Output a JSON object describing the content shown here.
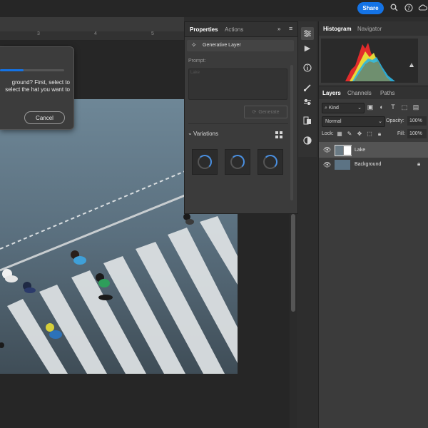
{
  "topbar": {
    "share_label": "Share",
    "icons": [
      "search-icon",
      "help-icon",
      "cloud-icon"
    ]
  },
  "ruler": {
    "ticks": [
      "3",
      "4",
      "5"
    ]
  },
  "dialog": {
    "message": "ground? First, select to select the hat you want to",
    "cancel_label": "Cancel",
    "progress_percent": 37
  },
  "properties": {
    "tabs": [
      "Properties",
      "Actions"
    ],
    "layer_type": "Generative Layer",
    "prompt_label": "Prompt:",
    "prompt_placeholder": "Lake",
    "generate_label": "Generate",
    "variations_label": "Variations"
  },
  "histogram": {
    "tabs": [
      "Histogram",
      "Navigator"
    ]
  },
  "layers": {
    "tabs": [
      "Layers",
      "Channels",
      "Paths"
    ],
    "kind_label": "Kind",
    "blend_mode": "Normal",
    "opacity_label": "Opacity:",
    "opacity_value": "100%",
    "lock_label": "Lock:",
    "fill_label": "Fill:",
    "fill_value": "100%",
    "items": [
      {
        "name": "Lake",
        "selected": true
      },
      {
        "name": "Background",
        "selected": false
      }
    ]
  },
  "colors": {
    "accent": "#1473e6",
    "panel": "#3b3b3b",
    "canvas": "#262626"
  }
}
